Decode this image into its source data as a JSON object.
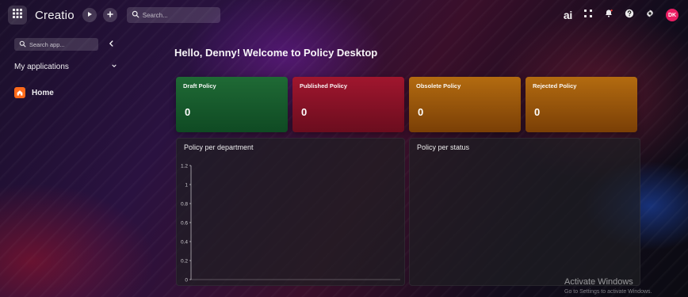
{
  "topbar": {
    "brand": "Creatio",
    "search_placeholder": "Search...",
    "right_text": "ai",
    "avatar_initials": "DK"
  },
  "sidebar": {
    "search_placeholder": "Search app...",
    "my_applications": "My applications",
    "home": "Home"
  },
  "main": {
    "welcome": "Hello, Denny! Welcome to Policy Desktop",
    "cards": [
      {
        "label": "Draft Policy",
        "value": "0"
      },
      {
        "label": "Published Policy",
        "value": "0"
      },
      {
        "label": "Obsolete Policy",
        "value": "0"
      },
      {
        "label": "Rejected Policy",
        "value": "0"
      }
    ],
    "panels": {
      "department_title": "Policy per department",
      "status_title": "Policy per status"
    }
  },
  "chart_data": {
    "type": "bar",
    "title": "Policy per department",
    "categories": [],
    "values": [],
    "ylim": [
      0,
      1.2
    ],
    "yticks": [
      "1.2",
      "1",
      "0.8",
      "0.6",
      "0.4",
      "0.2",
      "0"
    ]
  },
  "os_overlay": {
    "activate_title": "Activate Windows",
    "activate_sub": "Go to Settings to activate Windows."
  },
  "icons": {
    "apps_grid": "grid-icon",
    "play": "play-icon",
    "plus": "plus-icon",
    "search": "search-icon",
    "collapse": "chevron-left-icon",
    "dropdown": "chevron-down-icon",
    "home": "home-icon",
    "grid_small": "grid-small-icon",
    "bell": "bell-icon",
    "help": "help-icon",
    "settings": "gear-icon"
  },
  "colors": {
    "draft": "#1f6a35",
    "published": "#a0162e",
    "obsolete": "#b36b10",
    "rejected": "#b36b10",
    "home_accent": "#ff6a1a",
    "avatar": "#e91e63"
  }
}
